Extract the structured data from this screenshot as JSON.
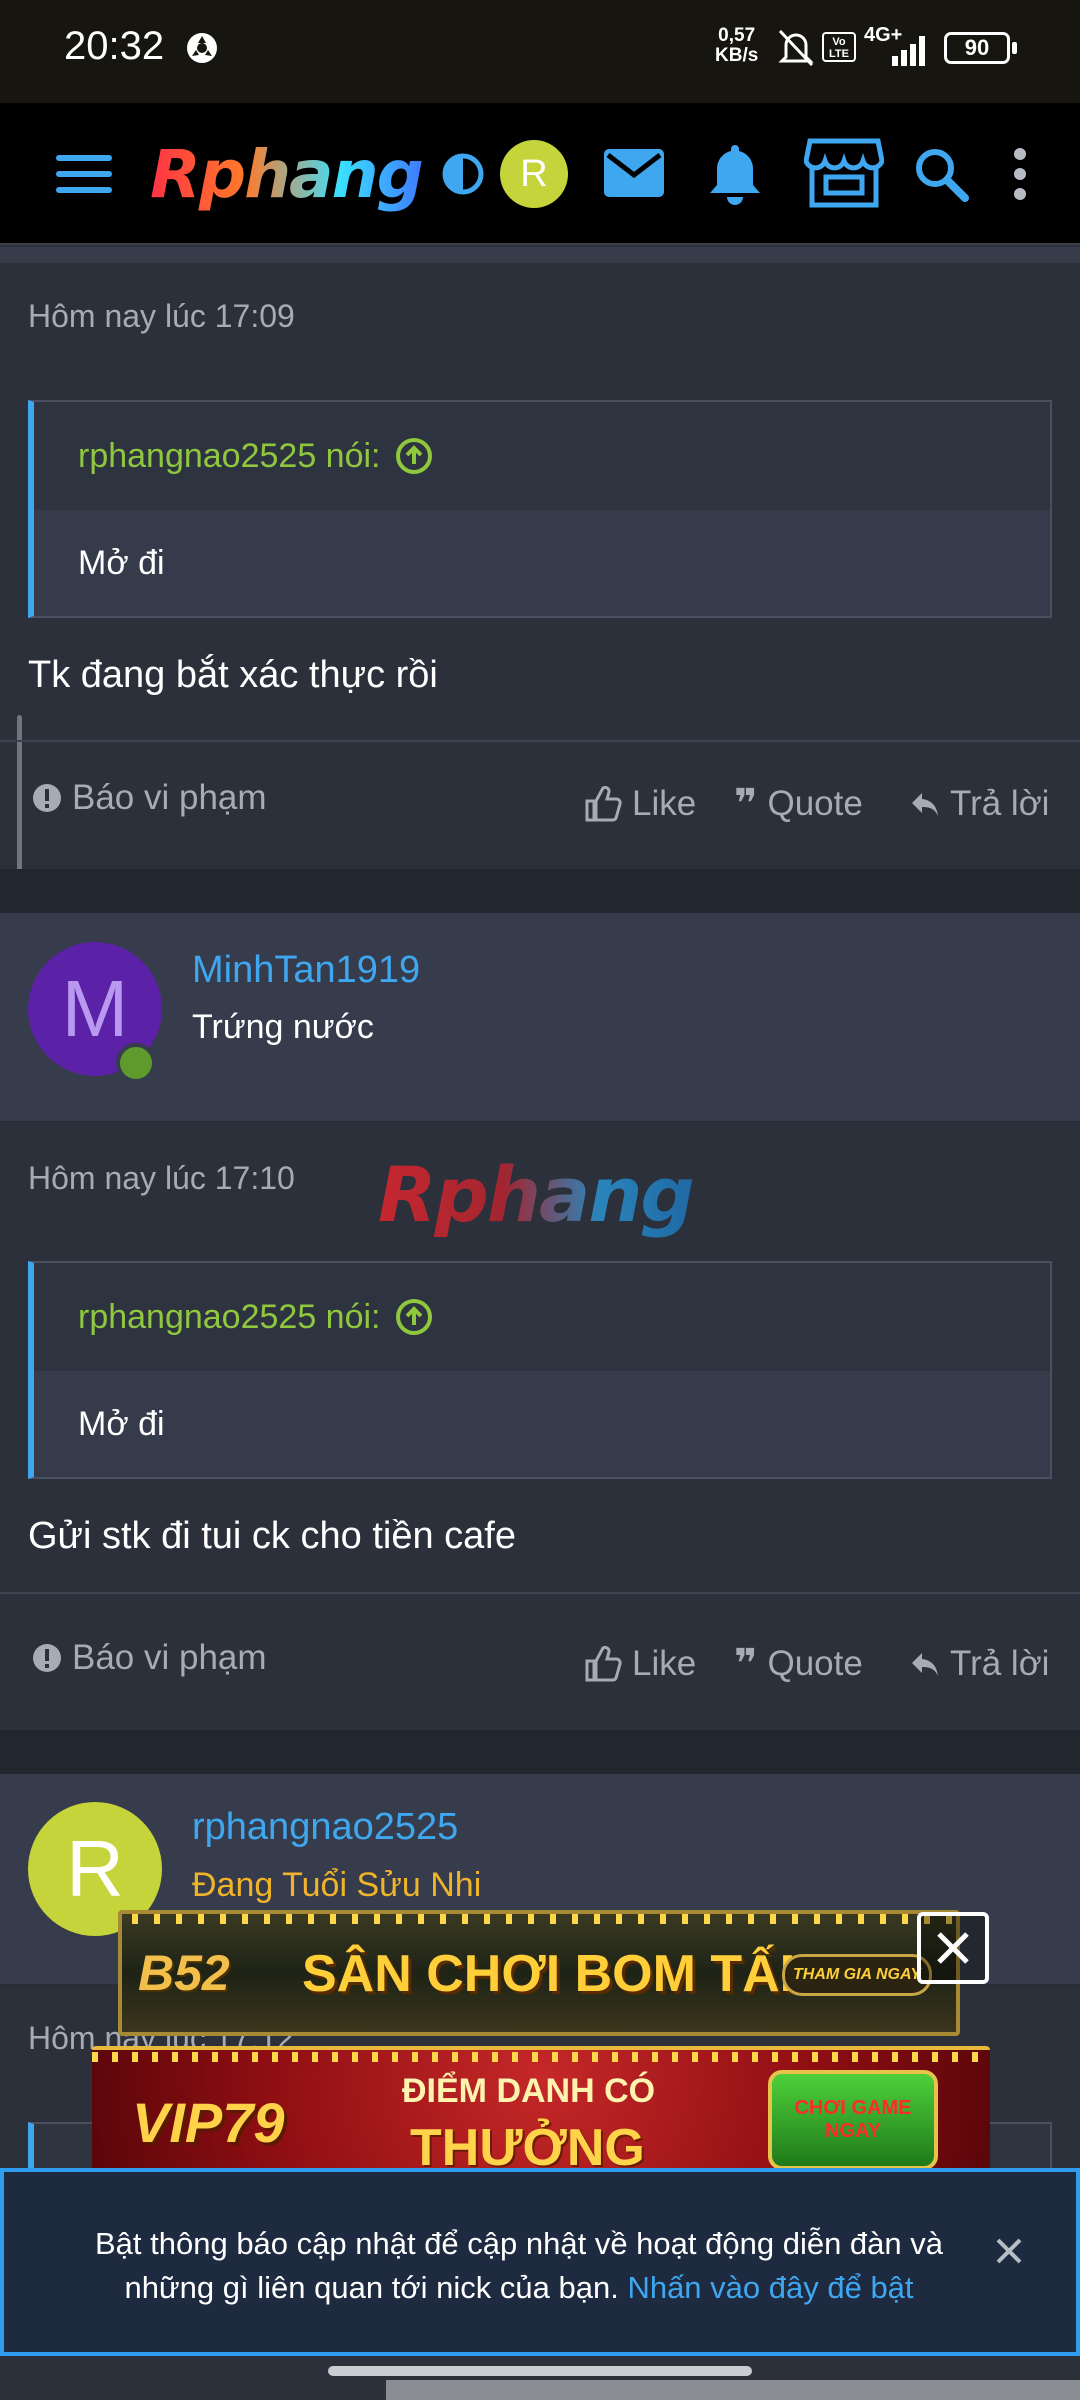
{
  "status_bar": {
    "time": "20:32",
    "net_speed_value": "0,57",
    "net_speed_unit": "KB/s",
    "network": "4G+",
    "volte": "Vo LTE",
    "battery": "90"
  },
  "navbar": {
    "logo": "Rphang",
    "user_initial": "R",
    "icons": [
      "menu-icon",
      "theme-toggle-icon",
      "mail-icon",
      "bell-icon",
      "store-icon",
      "search-icon",
      "more-vertical-icon"
    ]
  },
  "posts": [
    {
      "timestamp": "Hôm nay lúc 17:09",
      "quote_author": "rphangnao2525 nói:",
      "quote_text": "Mở đi",
      "message": "Tk đang bắt xác thực rồi",
      "report_label": "Báo vi phạm",
      "like_label": "Like",
      "quote_label": "Quote",
      "reply_label": "Trả lời"
    },
    {
      "user": {
        "initial": "M",
        "name": "MinhTan1919",
        "title": "Trứng nước"
      },
      "timestamp": "Hôm nay lúc 17:10",
      "watermark": "Rphang",
      "quote_author": "rphangnao2525 nói:",
      "quote_text": "Mở đi",
      "message": "Gửi stk đi tui ck cho tiền cafe",
      "report_label": "Báo vi phạm",
      "like_label": "Like",
      "quote_label": "Quote",
      "reply_label": "Trả lời"
    },
    {
      "user": {
        "initial": "R",
        "name": "rphangnao2525",
        "title": "Đang Tuổi Sửu Nhi"
      },
      "timestamp": "Hôm nay lúc 17:12"
    }
  ],
  "ads": {
    "banner1_text": "SÂN CHƠI BOM TẤN",
    "banner1_brand": "B52",
    "banner1_cta": "THAM GIA NGAY",
    "banner2_brand": "VIP79",
    "banner2_line1": "ĐIỂM DANH CÓ",
    "banner2_line2": "THƯỞNG",
    "banner2_cta": "CHƠI GAME NGAY"
  },
  "notification": {
    "text": "Bật thông báo cập nhật để cập nhật về hoạt động diễn đàn và những gì liên quan tới nick của bạn.",
    "link": "Nhấn vào đây để bật"
  },
  "colors": {
    "accent": "#3fa7f0",
    "quote_author": "#8fc73e",
    "usertitle_gold": "#f0b429",
    "avatar_purple": "#5b21a6",
    "avatar_lime": "#c5d43a"
  }
}
